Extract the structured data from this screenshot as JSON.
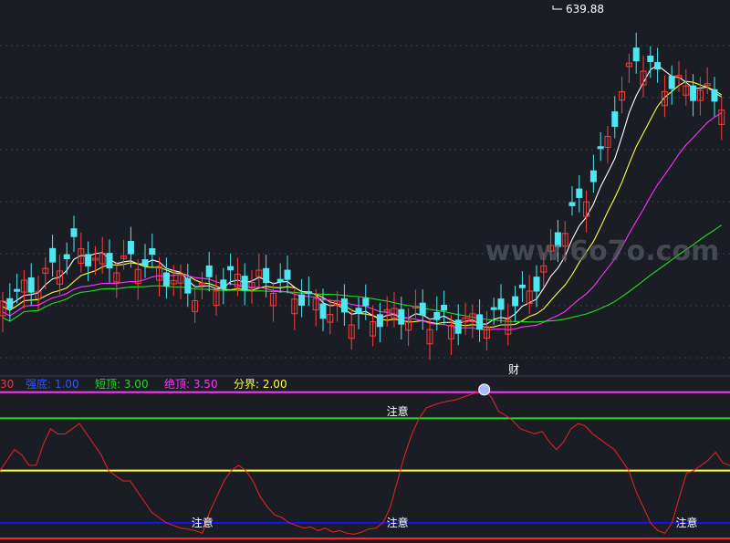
{
  "watermark": "www.6o7o.com",
  "main_chart": {
    "type": "candlestick",
    "peak_label": "639.88",
    "marker_text": "财",
    "colors": {
      "up": "#ff3b3b",
      "down": "#4ee6f0",
      "ma5": "#ffffff",
      "ma10": "#ffff33",
      "ma20": "#ff33ff",
      "ma60": "#22dd22"
    }
  },
  "chart_data": {
    "type": "line",
    "indicator": {
      "legend": [
        {
          "text": "30",
          "color": "#ff3333"
        },
        {
          "text": "强底: 1.00",
          "color": "#3355ff"
        },
        {
          "text": "短顶: 3.00",
          "color": "#22dd22"
        },
        {
          "text": "绝顶: 3.50",
          "color": "#ff33ff"
        },
        {
          "text": "分界: 2.00",
          "color": "#ffff33"
        }
      ],
      "levels": [
        {
          "value": 3.5,
          "color": "#ff33ff"
        },
        {
          "value": 3.0,
          "color": "#22dd22"
        },
        {
          "value": 2.0,
          "color": "#ffff33"
        },
        {
          "value": 1.0,
          "color": "#1111ff"
        },
        {
          "value": 0.7,
          "color": "#ff2222"
        }
      ],
      "ylim": [
        0.7,
        3.6
      ],
      "annotations": [
        {
          "text": "注意",
          "i": 55,
          "value": 3.13
        },
        {
          "text": "注意",
          "i": 28,
          "value": 1.0
        },
        {
          "text": "注意",
          "i": 55,
          "value": 1.0
        },
        {
          "text": "注意",
          "i": 95,
          "value": 1.0
        }
      ],
      "values": [
        2.0,
        2.2,
        2.4,
        2.3,
        2.1,
        2.1,
        2.5,
        2.8,
        2.7,
        2.7,
        2.8,
        2.9,
        2.7,
        2.5,
        2.3,
        2.0,
        1.9,
        1.8,
        1.8,
        1.6,
        1.4,
        1.2,
        1.1,
        1.0,
        0.95,
        0.9,
        0.88,
        0.85,
        0.8,
        1.2,
        1.5,
        1.8,
        2.0,
        2.1,
        2.0,
        1.8,
        1.5,
        1.3,
        1.15,
        1.1,
        1.0,
        0.95,
        0.9,
        0.92,
        0.85,
        0.9,
        0.82,
        0.85,
        0.8,
        0.78,
        0.82,
        0.88,
        0.9,
        1.0,
        1.3,
        1.8,
        2.3,
        2.7,
        3.0,
        3.2,
        3.25,
        3.3,
        3.33,
        3.35,
        3.4,
        3.45,
        3.5,
        3.55,
        3.4,
        3.13,
        3.05,
        2.95,
        2.8,
        2.75,
        2.7,
        2.75,
        2.55,
        2.4,
        2.55,
        2.8,
        2.9,
        2.85,
        2.7,
        2.6,
        2.5,
        2.4,
        2.2,
        2.0,
        1.6,
        1.3,
        1.0,
        0.85,
        0.8,
        1.0,
        1.5,
        1.95,
        2.0,
        2.1,
        2.2,
        2.35,
        2.15,
        2.1
      ]
    }
  }
}
